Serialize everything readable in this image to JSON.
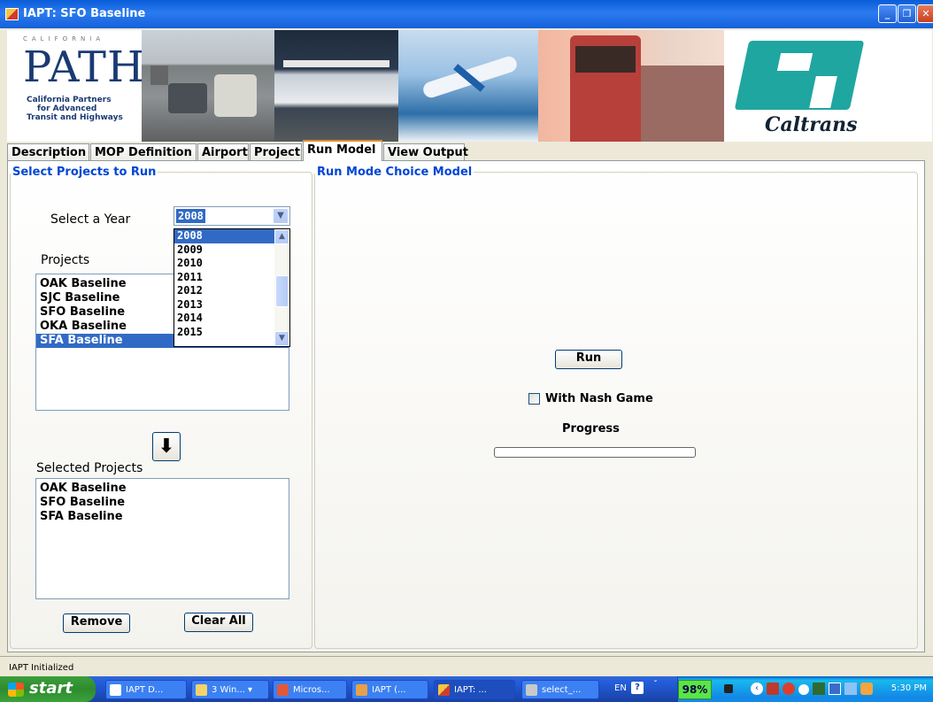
{
  "window": {
    "title": "IAPT: SFO Baseline"
  },
  "banner": {
    "path_logo": {
      "word": "PATH",
      "arc": "CALIFORNIA",
      "tag1": "California Partners",
      "tag2": "for Advanced",
      "tag3": "Transit and Highways"
    },
    "caltrans_logo": "Caltrans"
  },
  "tabs": [
    "Description",
    "MOP Definition",
    "Airport",
    "Project",
    "Run Model",
    "View Output"
  ],
  "select_group": {
    "legend": "Select Projects to Run",
    "year_label": "Select a Year",
    "year_value": "2008",
    "year_options": [
      "2008",
      "2009",
      "2010",
      "2011",
      "2012",
      "2013",
      "2014",
      "2015"
    ],
    "projects_label": "Projects",
    "projects": [
      "OAK Baseline",
      "SJC Baseline",
      "SFO Baseline",
      "OKA Baseline",
      "SFA Baseline"
    ],
    "selected_label": "Selected Projects",
    "selected_projects": [
      "OAK Baseline",
      "SFO Baseline",
      "SFA Baseline"
    ],
    "remove_label": "Remove",
    "clear_label": "Clear All"
  },
  "run_group": {
    "legend": "Run Mode Choice Model",
    "run_label": "Run",
    "nash_label": "With Nash Game",
    "nash_checked": false,
    "progress_label": "Progress",
    "progress_value": 0
  },
  "status": "IAPT Initialized",
  "taskbar": {
    "start": "start",
    "tasks": [
      "IAPT D...",
      "3 Win...",
      "Micros...",
      "IAPT (...",
      "IAPT: ...",
      "select_..."
    ],
    "lang": "EN",
    "battery": "98%",
    "clock": "5:30 PM"
  },
  "colors": {
    "accent": "#0046D5",
    "selection": "#316AC5",
    "titlebar": "#0A5CD8"
  }
}
